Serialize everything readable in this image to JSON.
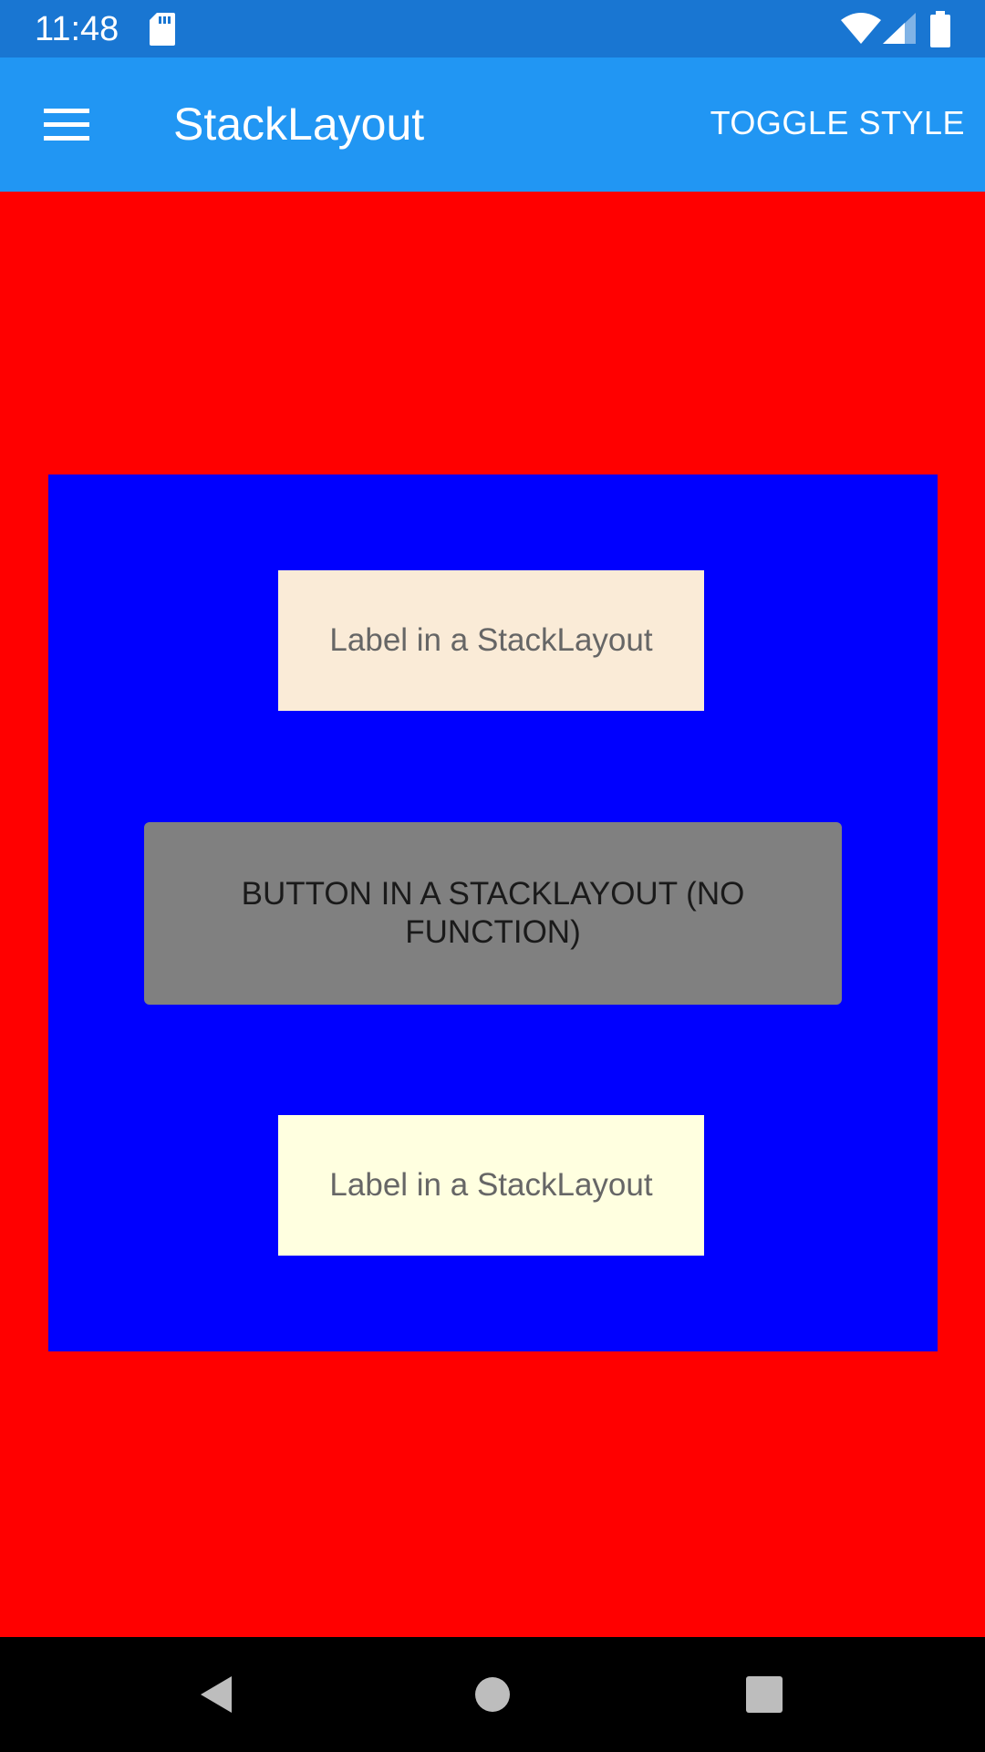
{
  "status_bar": {
    "time": "11:48",
    "icons": [
      "sd-card-icon",
      "wifi-icon",
      "signal-icon",
      "battery-icon"
    ],
    "color": "#1976d2"
  },
  "app_bar": {
    "title": "StackLayout",
    "menu_icon": "hamburger-menu-icon",
    "action_label": "TOGGLE STYLE",
    "color": "#2196f3"
  },
  "page": {
    "background_color": "#ff0000",
    "stack_color": "#0000ff",
    "label_top": {
      "text": "Label in a StackLayout",
      "background_color": "#faebd7"
    },
    "button": {
      "text": "BUTTON IN A STACKLAYOUT (NO FUNCTION)",
      "background_color": "#808080"
    },
    "label_bottom": {
      "text": "Label in a StackLayout",
      "background_color": "#ffffe0"
    }
  },
  "nav_bar": {
    "icons": [
      "back-icon",
      "home-icon",
      "recents-icon"
    ]
  }
}
